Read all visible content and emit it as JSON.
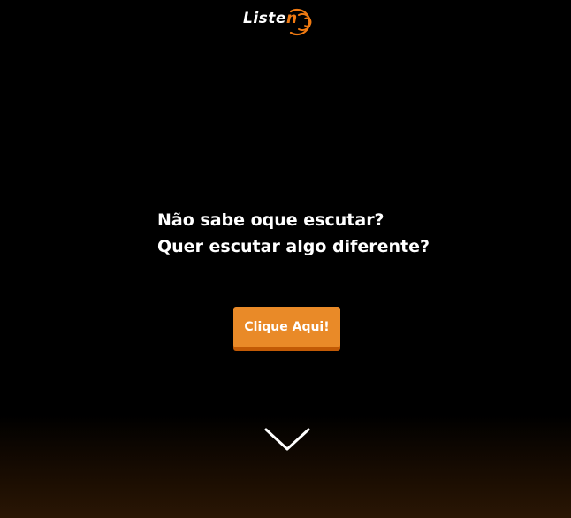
{
  "header": {
    "logo_text_main": "Liste",
    "logo_text_accent": "n",
    "logo_alt": "Listen"
  },
  "hero": {
    "line1": "Não sabe oque escutar?",
    "line2": "Quer escutar algo diferente?",
    "cta_label": "Clique Aqui!"
  },
  "icons": {
    "logo": "sound-waves-icon",
    "scroll": "chevron-down-icon"
  },
  "colors": {
    "background": "#000000",
    "accent": "#f07a12",
    "button": "#e98a28",
    "button_shadow": "#c25a05",
    "text": "#ffffff"
  }
}
